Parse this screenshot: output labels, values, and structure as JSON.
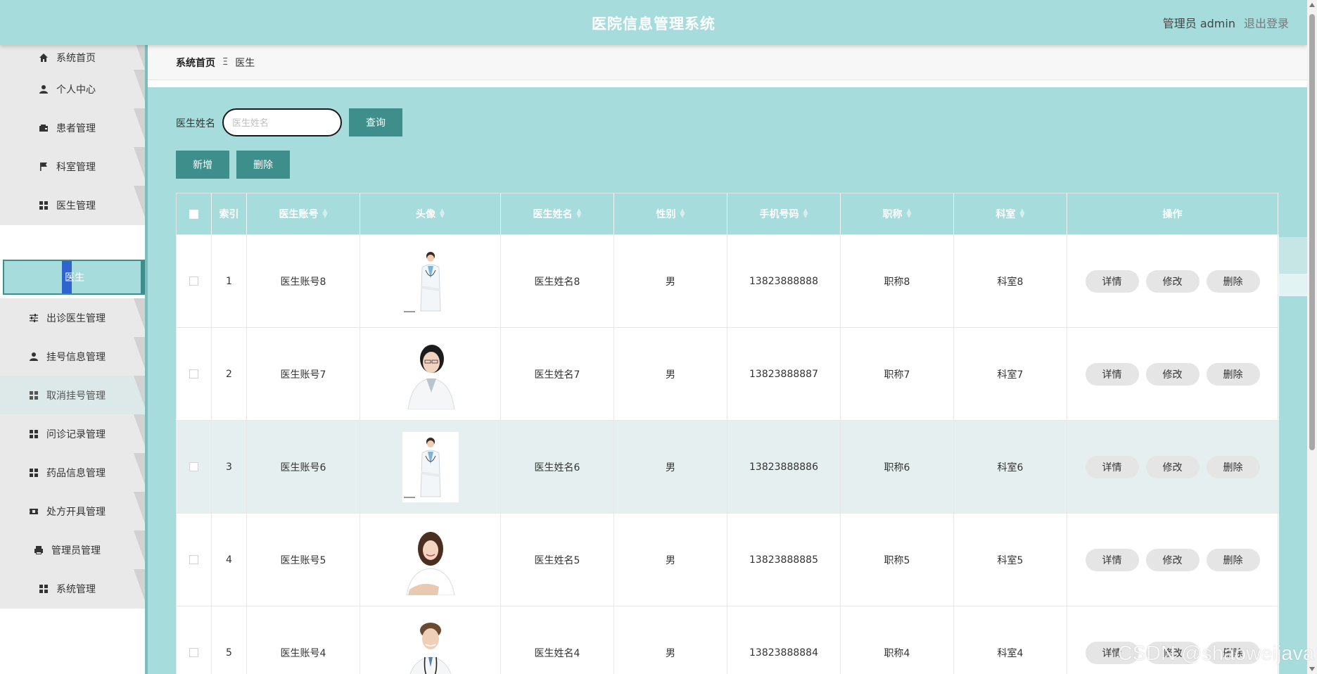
{
  "header": {
    "title": "医院信息管理系统",
    "user": "管理员 admin",
    "logout": "退出登录"
  },
  "sidebar": {
    "items": [
      {
        "label": "系统首页",
        "icon": "home-icon"
      },
      {
        "label": "个人中心",
        "icon": "user-icon"
      },
      {
        "label": "患者管理",
        "icon": "wallet-icon"
      },
      {
        "label": "科室管理",
        "icon": "flag-icon"
      },
      {
        "label": "医生管理",
        "icon": "grid-icon"
      },
      {
        "label": "出诊医生管理",
        "icon": "sliders-icon"
      },
      {
        "label": "挂号信息管理",
        "icon": "user-icon"
      },
      {
        "label": "取消挂号管理",
        "icon": "grid-icon"
      },
      {
        "label": "问诊记录管理",
        "icon": "grid-icon"
      },
      {
        "label": "药品信息管理",
        "icon": "grid-icon"
      },
      {
        "label": "处方开具管理",
        "icon": "ticket-icon"
      },
      {
        "label": "管理员管理",
        "icon": "printer-icon"
      },
      {
        "label": "系统管理",
        "icon": "grid-icon"
      }
    ],
    "active_sub": "医生"
  },
  "breadcrumb": {
    "home": "系统首页",
    "separator": "Ξ",
    "current": "医生"
  },
  "search": {
    "label": "医生姓名",
    "placeholder": "医生姓名",
    "value": "",
    "button": "查询"
  },
  "actions": {
    "add": "新增",
    "delete": "删除"
  },
  "table": {
    "columns": [
      "索引",
      "医生账号",
      "头像",
      "医生姓名",
      "性别",
      "手机号码",
      "职称",
      "科室",
      "操作"
    ],
    "rows": [
      {
        "index": "1",
        "account": "医生账号8",
        "name": "医生姓名8",
        "sex": "男",
        "phone": "13823888888",
        "title": "职称8",
        "dept": "科室8"
      },
      {
        "index": "2",
        "account": "医生账号7",
        "name": "医生姓名7",
        "sex": "男",
        "phone": "13823888887",
        "title": "职称7",
        "dept": "科室7"
      },
      {
        "index": "3",
        "account": "医生账号6",
        "name": "医生姓名6",
        "sex": "男",
        "phone": "13823888886",
        "title": "职称6",
        "dept": "科室6"
      },
      {
        "index": "4",
        "account": "医生账号5",
        "name": "医生姓名5",
        "sex": "男",
        "phone": "13823888885",
        "title": "职称5",
        "dept": "科室5"
      },
      {
        "index": "5",
        "account": "医生账号4",
        "name": "医生姓名4",
        "sex": "男",
        "phone": "13823888884",
        "title": "职称4",
        "dept": "科室4"
      }
    ],
    "row_actions": {
      "detail": "详情",
      "edit": "修改",
      "delete": "删除"
    }
  },
  "watermark": "CSDN @shaoweijava"
}
